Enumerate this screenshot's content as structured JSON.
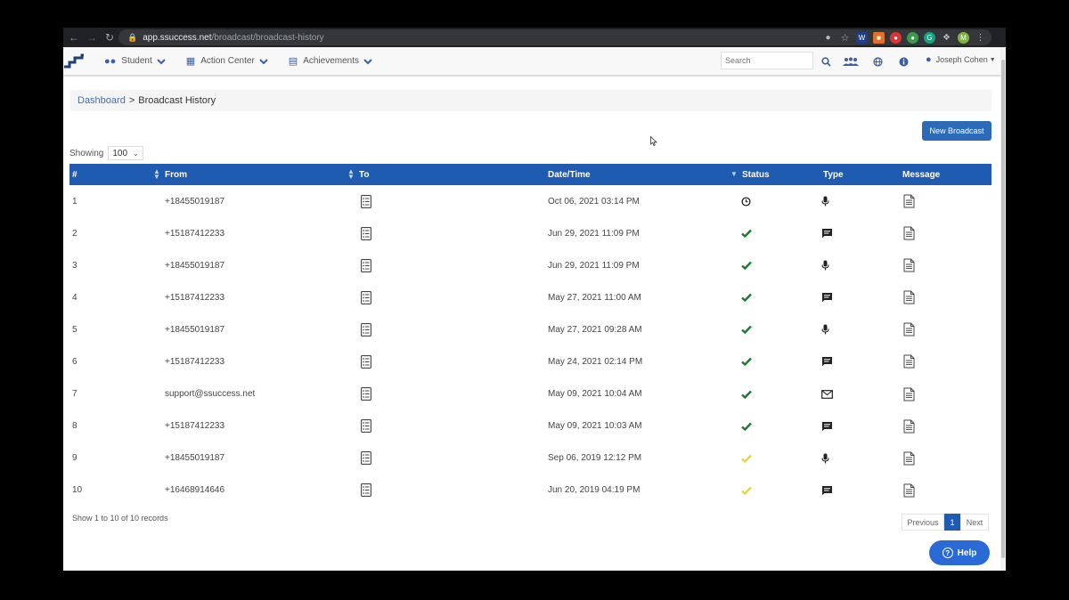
{
  "browser": {
    "url_host": "app.ssuccess.net",
    "url_path": "/broadcast/broadcast-history",
    "profile_initial": "M"
  },
  "nav": {
    "items": [
      {
        "label": "Student",
        "icon": "users-icon"
      },
      {
        "label": "Action Center",
        "icon": "calendar-icon"
      },
      {
        "label": "Achievements",
        "icon": "list-icon"
      }
    ],
    "search_placeholder": "Search",
    "user_name": "Joseph Cohen"
  },
  "breadcrumb": {
    "link": "Dashboard",
    "separator": ">",
    "current": "Broadcast History"
  },
  "new_broadcast_label": "New Broadcast",
  "showing": {
    "label": "Showing",
    "value": "100"
  },
  "table": {
    "columns": [
      "#",
      "From",
      "To",
      "Date/Time",
      "Status",
      "Type",
      "Message"
    ],
    "rows": [
      {
        "num": "1",
        "from": "+18455019187",
        "datetime": "Oct 06, 2021 03:14 PM",
        "status": "pending",
        "type": "voice"
      },
      {
        "num": "2",
        "from": "+15187412233",
        "datetime": "Jun 29, 2021 11:09 PM",
        "status": "sent",
        "type": "sms"
      },
      {
        "num": "3",
        "from": "+18455019187",
        "datetime": "Jun 29, 2021 11:09 PM",
        "status": "sent",
        "type": "voice"
      },
      {
        "num": "4",
        "from": "+15187412233",
        "datetime": "May 27, 2021 11:00 AM",
        "status": "sent",
        "type": "sms"
      },
      {
        "num": "5",
        "from": "+18455019187",
        "datetime": "May 27, 2021 09:28 AM",
        "status": "sent",
        "type": "voice"
      },
      {
        "num": "6",
        "from": "+15187412233",
        "datetime": "May 24, 2021 02:14 PM",
        "status": "sent",
        "type": "sms"
      },
      {
        "num": "7",
        "from": "support@ssuccess.net",
        "datetime": "May 09, 2021 10:04 AM",
        "status": "sent",
        "type": "email"
      },
      {
        "num": "8",
        "from": "+15187412233",
        "datetime": "May 09, 2021 10:03 AM",
        "status": "sent",
        "type": "sms"
      },
      {
        "num": "9",
        "from": "+18455019187",
        "datetime": "Sep 06, 2019 12:12 PM",
        "status": "partial",
        "type": "voice"
      },
      {
        "num": "10",
        "from": "+16468914646",
        "datetime": "Jun 20, 2019 04:19 PM",
        "status": "partial",
        "type": "sms"
      }
    ]
  },
  "colors": {
    "header_blue": "#1f5cb1",
    "status_sent": "#1e7a2e",
    "status_partial": "#e8d53a",
    "accent": "#2b6bb8"
  },
  "records_text": "Show 1 to 10 of 10 records",
  "pagination": {
    "previous": "Previous",
    "current": "1",
    "next": "Next"
  },
  "help_label": "Help"
}
